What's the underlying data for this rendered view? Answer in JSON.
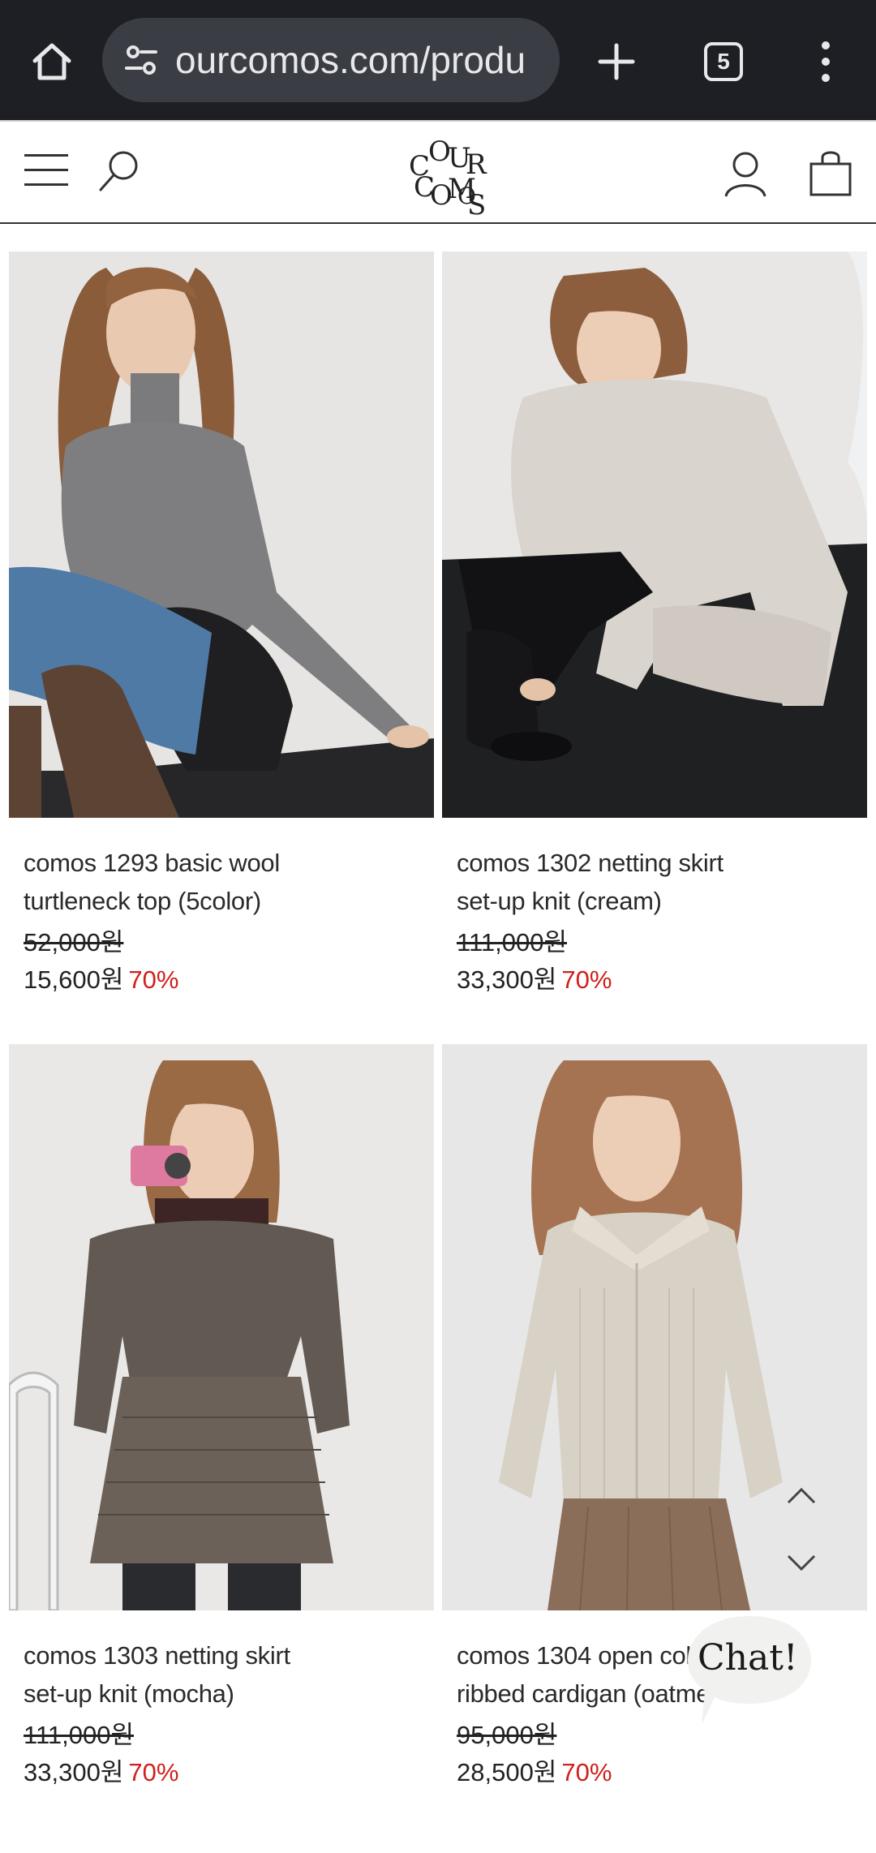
{
  "browser": {
    "url": "ourcomos.com/produ",
    "tab_count": "5"
  },
  "site": {
    "logo_letters": [
      "C",
      "O",
      "U",
      "R",
      "C",
      "O",
      "M",
      "O",
      "S"
    ]
  },
  "products": [
    {
      "name_line1": "comos 1293 basic wool",
      "name_line2": "turtleneck top (5color)",
      "original_price": "52,000원",
      "sale_price": "15,600원",
      "discount": "70%"
    },
    {
      "name_line1": "comos 1302 netting skirt",
      "name_line2": "set-up knit (cream)",
      "original_price": "111,000원",
      "sale_price": "33,300원",
      "discount": "70%"
    },
    {
      "name_line1": "comos 1303 netting skirt",
      "name_line2": "set-up knit (mocha)",
      "original_price": "111,000원",
      "sale_price": "33,300원",
      "discount": "70%"
    },
    {
      "name_line1": "comos 1304 open col",
      "name_line2": "ribbed cardigan (oatme",
      "original_price": "95,000원",
      "sale_price": "28,500원",
      "discount": "70%"
    }
  ],
  "chat": {
    "label": "Chat!"
  },
  "colors": {
    "browser_bar": "#1d1f24",
    "url_pill": "#3a3d44",
    "discount_red": "#d0201a"
  }
}
